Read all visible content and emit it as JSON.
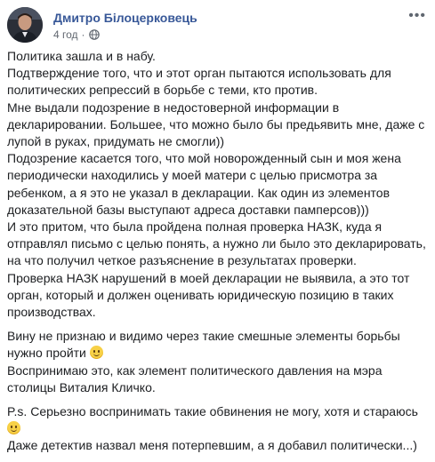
{
  "post": {
    "author": "Дмитро Білоцерковець",
    "time": "4 год",
    "separator": "·",
    "more_label": "•••",
    "privacy_icon": "globe-icon",
    "emoji_icon": "slightly-smiling-face-emoji",
    "paragraphs": [
      {
        "lines": [
          "Политика зашла и в набу.",
          "Подтверждение того, что и этот орган пытаются использовать для",
          "политических репрессий в борьбе с теми, кто против.",
          "Мне выдали подозрение в недостоверной информации в",
          "декларировании. Большее, что можно было бы предьявить мне, даже с",
          "лупой в руках, придумать не смогли))",
          "Подозрение касается того, что мой новорожденный сын и моя жена",
          "периодически находились у моей матери с целью присмотра за",
          "ребенком, а я это не указал в декларации. Как один из элементов",
          "доказательной базы выступают адреса доставки памперсов)))",
          "И это притом, что была пройдена полная проверка НАЗК, куда я",
          "отправлял письмо с целью понять, а нужно ли было это декларировать,",
          "на что получил четкое разъяснение в результатах проверки.",
          "Проверка НАЗК нарушений в моей декларации не выявила, а это тот",
          "орган, который и должен оценивать юридическую позицию в таких",
          "производствах."
        ]
      },
      {
        "lines": [
          "Вину не признаю и видимо через такие смешные элементы борьбы",
          "нужно пройти",
          "Воспринимаю это, как элемент политического давления на мэра",
          "столицы Виталия Кличко."
        ]
      },
      {
        "lines": [
          "P.s. Серьезно воспринимать такие обвинения не могу, хотя и стараюсь",
          "",
          "Даже детектив назвал меня потерпевшим, а я добавил политически...)"
        ]
      }
    ]
  },
  "colors": {
    "author": "#385898",
    "text": "#1c1e21",
    "meta": "#616770"
  }
}
